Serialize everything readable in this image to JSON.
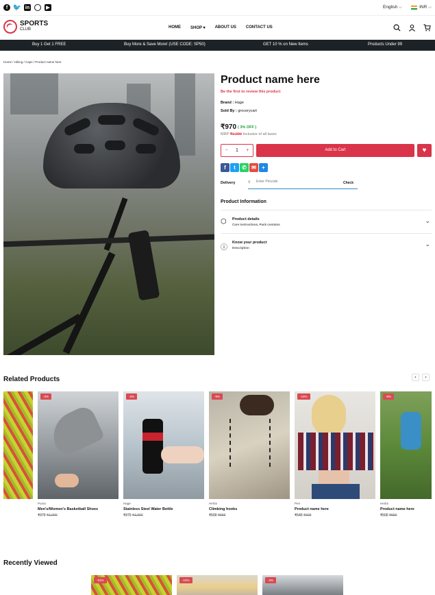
{
  "topbar": {
    "language": "English ⌵",
    "currency": "INR ⌵"
  },
  "header": {
    "logo_line1": "SPORTS",
    "logo_line2": "CLUB",
    "nav": [
      "HOME",
      "SHOP ▾",
      "ABOUT US",
      "CONTACT US"
    ]
  },
  "promo": [
    "Buy 1 Get 1 FREE",
    "Buy More & Save More! (USE CODE: SP50)",
    "GET 10 % on New Items",
    "Products Under 99"
  ],
  "breadcrumb": "Home  /  Hiking  /  Caps  /  Product name here",
  "product": {
    "title": "Product name here",
    "review": "Be the first to review this product",
    "brand_label": "Brand :",
    "brand": " Hage",
    "soldby_label": "Sold By :",
    "soldby": " grocerycart",
    "price": "₹970",
    "discount": "( 3% OFF )",
    "mrp_label": "MRP ",
    "mrp": "₹1,000",
    "tax": " Inclusive of all taxes",
    "qty": "1",
    "cart_label": "Add to Cart",
    "delivery_label": "Delivery",
    "pincode_placeholder": "Enter Pincode",
    "check_label": "Check",
    "info_title": "Product Information",
    "accordion": [
      {
        "title": "Product details",
        "subtitle": "Care instructions, Pack contains"
      },
      {
        "title": "Know your product",
        "subtitle": "Description"
      }
    ]
  },
  "related": {
    "title": "Related Products",
    "items": [
      {
        "badge": "-3%",
        "brand": "Puma",
        "name": "Men's/Women's Basketball Shoes",
        "price": "₹970",
        "mrp": "₹1,000"
      },
      {
        "badge": "-3%",
        "brand": "Hage",
        "name": "Stainless Steel Water Bottle",
        "price": "₹970",
        "mrp": "₹1,000"
      },
      {
        "badge": "-9%",
        "brand": "Herbs",
        "name": "Climbing hooks",
        "price": "₹500",
        "mrp": "₹550"
      },
      {
        "badge": "-10%",
        "brand": "Peri",
        "name": "Product name here",
        "price": "₹540",
        "mrp": "₹600"
      },
      {
        "badge": "-9%",
        "brand": "Herbs",
        "name": "Product name here",
        "price": "₹500",
        "mrp": "₹550"
      }
    ]
  },
  "recent": {
    "title": "Recently Viewed",
    "badges": [
      "-31%",
      "-10%",
      "-3%"
    ]
  },
  "colors": {
    "accent": "#d93449",
    "promo_bg": "#1d2226"
  }
}
